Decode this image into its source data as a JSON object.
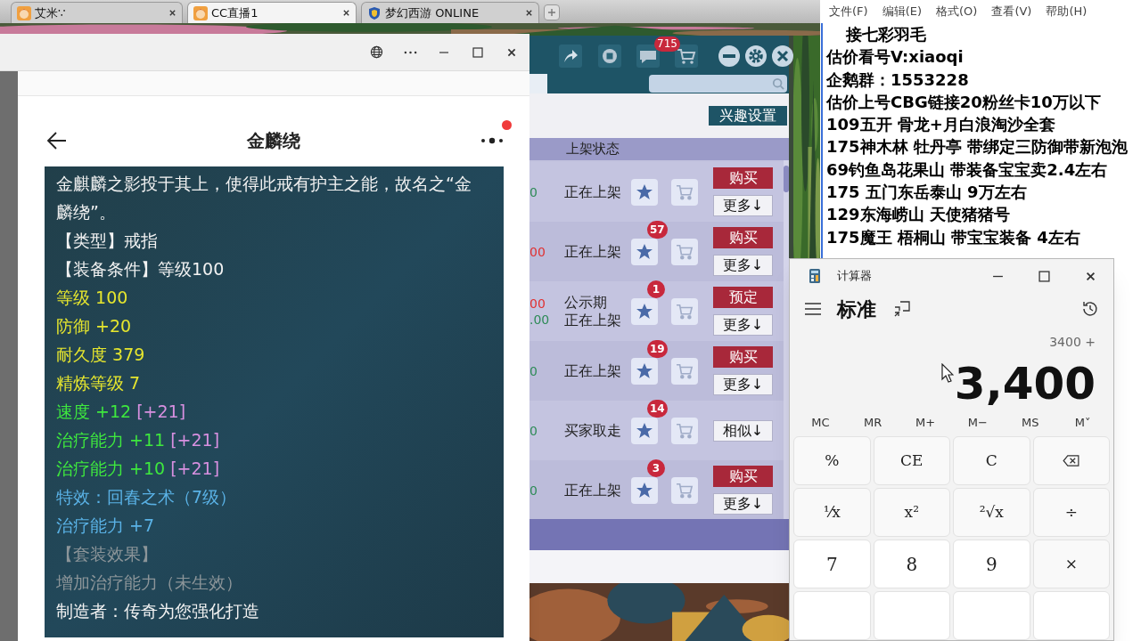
{
  "browser_tabs": [
    {
      "label": "艾米∵",
      "kind": "avatar",
      "selected": false
    },
    {
      "label": "CC直播1",
      "kind": "avatar",
      "selected": true
    },
    {
      "label": "梦幻西游 ONLINE",
      "kind": "shield",
      "selected": false
    }
  ],
  "item_window": {
    "page_title": "金麟绕",
    "notification": true,
    "lines": [
      {
        "text": "金麒麟之影投于其上，使得此戒有护主之能，故名之“金麟绕”。",
        "color": "#f2f2f2"
      },
      {
        "text": "【类型】戒指",
        "color": "#f2f2f2"
      },
      {
        "text": "【装备条件】等级100",
        "color": "#f2f2f2"
      },
      {
        "text": "等级 100",
        "color": "#e6e62e"
      },
      {
        "text": "防御 +20",
        "color": "#e6e62e"
      },
      {
        "text": "耐久度 379",
        "color": "#e6e62e"
      },
      {
        "text": "精炼等级 7",
        "color": "#e6e62e"
      },
      {
        "text": "速度 +12",
        "color": "#3ee83e",
        "bonus": "[+21]"
      },
      {
        "text": "治疗能力 +11",
        "color": "#3ee83e",
        "bonus": "[+21]"
      },
      {
        "text": "治疗能力 +10",
        "color": "#3ee83e",
        "bonus": "[+21]"
      },
      {
        "text": "特效：回春之术（7级）",
        "color": "#5ab2e6"
      },
      {
        "text": "治疗能力 +7",
        "color": "#5ab2e6"
      },
      {
        "text": "【套装效果】",
        "color": "#8c9599"
      },
      {
        "text": "增加治疗能力（未生效）",
        "color": "#8c9599"
      },
      {
        "text": "制造者：传奇为您强化打造",
        "color": "#f2f2f2"
      }
    ]
  },
  "market_panel": {
    "unread_count": "715",
    "interest_button": "兴趣设置",
    "column_header": "上架状态",
    "rows": [
      {
        "prices": [
          {
            "text": "0",
            "color": "#2e8b57"
          }
        ],
        "status": [
          "正在上架"
        ],
        "favorites": null,
        "actions": [
          {
            "label": "购买",
            "kind": "primary"
          },
          {
            "label": "更多↓",
            "kind": "secondary"
          }
        ]
      },
      {
        "prices": [
          {
            "text": "00",
            "color": "#e03030"
          }
        ],
        "status": [
          "正在上架"
        ],
        "favorites": "57",
        "actions": [
          {
            "label": "购买",
            "kind": "primary"
          },
          {
            "label": "更多↓",
            "kind": "secondary"
          }
        ]
      },
      {
        "prices": [
          {
            "text": "00",
            "color": "#e03030"
          },
          {
            "text": ".00",
            "color": "#2e8b57"
          }
        ],
        "status": [
          "公示期",
          "正在上架"
        ],
        "favorites": "1",
        "actions": [
          {
            "label": "预定",
            "kind": "primary"
          },
          {
            "label": "更多↓",
            "kind": "secondary"
          }
        ]
      },
      {
        "prices": [
          {
            "text": "0",
            "color": "#2e8b57"
          }
        ],
        "status": [
          "正在上架"
        ],
        "favorites": "19",
        "actions": [
          {
            "label": "购买",
            "kind": "primary"
          },
          {
            "label": "更多↓",
            "kind": "secondary"
          }
        ]
      },
      {
        "prices": [
          {
            "text": "0",
            "color": "#2e8b57"
          }
        ],
        "status": [
          "买家取走"
        ],
        "favorites": "14",
        "actions": [
          {
            "label": "相似↓",
            "kind": "secondary"
          }
        ]
      },
      {
        "prices": [
          {
            "text": "0",
            "color": "#2e8b57"
          }
        ],
        "status": [
          "正在上架"
        ],
        "favorites": "3",
        "actions": [
          {
            "label": "购买",
            "kind": "primary"
          },
          {
            "label": "更多↓",
            "kind": "secondary"
          }
        ]
      }
    ]
  },
  "notepad": {
    "menu": [
      "文件(F)",
      "编辑(E)",
      "格式(O)",
      "查看(V)",
      "帮助(H)"
    ],
    "lines": [
      "接七彩羽毛",
      "估价看号V:xiaoqi",
      "企鹅群：1553228",
      "估价上号CBG链接20粉丝卡10万以下",
      "109五开 骨龙+月白浪淘沙全套",
      "175神木林 牡丹亭  带绑定三防御带新泡泡",
      "69钓鱼岛花果山 带装备宝宝卖2.4左右",
      "175 五门东岳泰山  9万左右",
      "129东海崂山 天使猪猪号",
      "175魔王 梧桐山  带宝宝装备 4左右"
    ]
  },
  "calculator": {
    "title": "计算器",
    "mode": "标准",
    "expression": "3400 +",
    "display": "3,400",
    "memory": [
      "MC",
      "MR",
      "M+",
      "M−",
      "MS",
      "M˅"
    ],
    "keys": [
      {
        "kind": "function",
        "label": "%"
      },
      {
        "kind": "function",
        "label": "CE"
      },
      {
        "kind": "function",
        "label": "C"
      },
      {
        "kind": "backspace"
      },
      {
        "kind": "function",
        "label": "⅟x"
      },
      {
        "kind": "function",
        "label": "x²"
      },
      {
        "kind": "function",
        "label": "²√x"
      },
      {
        "kind": "function",
        "label": "÷"
      },
      {
        "kind": "digit",
        "label": "7"
      },
      {
        "kind": "digit",
        "label": "8"
      },
      {
        "kind": "digit",
        "label": "9"
      },
      {
        "kind": "function",
        "label": "×"
      }
    ]
  }
}
